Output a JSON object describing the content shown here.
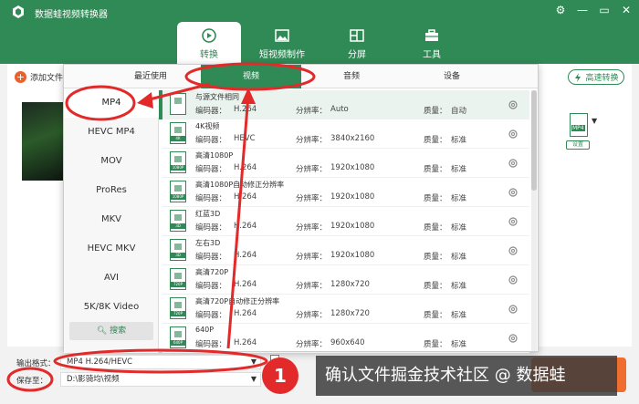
{
  "app": {
    "title": "数据蛙视频转换器",
    "window_controls": [
      "⚙",
      "—",
      "▭",
      "✕"
    ],
    "colors": {
      "brand": "#2f8a55",
      "accent": "#e32a2a",
      "convert": "#ee6d2f"
    }
  },
  "nav": {
    "tabs": [
      {
        "label": "转换",
        "icon": "convert-icon",
        "active": true
      },
      {
        "label": "短视频制作",
        "icon": "image-icon"
      },
      {
        "label": "分屏",
        "icon": "split-screen-icon"
      },
      {
        "label": "工具",
        "icon": "toolbox-icon"
      }
    ]
  },
  "main": {
    "add_file": "添加文件",
    "high_speed": "高速转换",
    "output_icon_label": "MP4",
    "output_settings": "设置"
  },
  "popup": {
    "tabs": [
      "最近使用",
      "视频",
      "音频",
      "设备"
    ],
    "active_tab": 1,
    "categories": [
      "MP4",
      "HEVC MP4",
      "MOV",
      "ProRes",
      "MKV",
      "HEVC MKV",
      "AVI",
      "5K/8K Video"
    ],
    "search": "搜索",
    "encoder_label": "编码器：",
    "resolution_label": "分辨率：",
    "quality_label": "质量：",
    "presets": [
      {
        "name": "与源文件相同",
        "encoder": "H.264",
        "resolution": "Auto",
        "quality": "自动",
        "tag": ""
      },
      {
        "name": "4K视频",
        "encoder": "HEVC",
        "resolution": "3840x2160",
        "quality": "标准",
        "tag": "4K"
      },
      {
        "name": "高清1080P",
        "encoder": "H.264",
        "resolution": "1920x1080",
        "quality": "标准",
        "tag": "1080P"
      },
      {
        "name": "高清1080P自动修正分辨率",
        "encoder": "H.264",
        "resolution": "1920x1080",
        "quality": "标准",
        "tag": "1080P"
      },
      {
        "name": "红蓝3D",
        "encoder": "H.264",
        "resolution": "1920x1080",
        "quality": "标准",
        "tag": "3D"
      },
      {
        "name": "左右3D",
        "encoder": "H.264",
        "resolution": "1920x1080",
        "quality": "标准",
        "tag": "3D"
      },
      {
        "name": "高清720P",
        "encoder": "H.264",
        "resolution": "1280x720",
        "quality": "标准",
        "tag": "720P"
      },
      {
        "name": "高清720P自动修正分辨率",
        "encoder": "H.264",
        "resolution": "1280x720",
        "quality": "标准",
        "tag": "720P"
      },
      {
        "name": "640P",
        "encoder": "H.264",
        "resolution": "960x640",
        "quality": "标准",
        "tag": "640P"
      }
    ]
  },
  "bottom": {
    "output_format_label": "输出格式：",
    "output_format_value": "MP4 H.264/HEVC",
    "save_to_label": "保存至：",
    "save_to_value": "D:\\影骑均\\视频",
    "convert_button": "确认文件",
    "step_number": "1",
    "watermark": "确认文件掘金技术社区 @ 数据蛙"
  }
}
